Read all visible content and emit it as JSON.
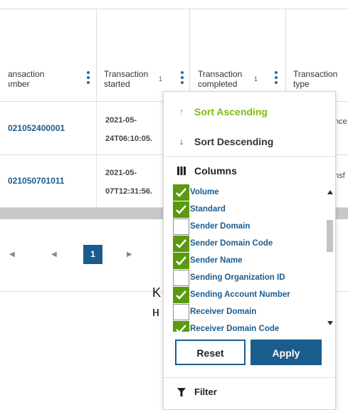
{
  "columns": [
    {
      "label_line1": "ansaction",
      "label_line2": "ımber"
    },
    {
      "label_line1": "Transaction",
      "label_line2": "started",
      "sort_index": "1"
    },
    {
      "label_line1": "Transaction",
      "label_line2": "completed",
      "sort_index": "1"
    },
    {
      "label_line1": "Transaction",
      "label_line2": "type"
    }
  ],
  "rows": [
    {
      "number": "021052400001",
      "started_line1": "2021-05-",
      "started_line2": "24T06:10:05.",
      "type_fragment": "nce"
    },
    {
      "number": "021050701011",
      "started_line1": "2021-05-",
      "started_line2": "07T12:31:56.",
      "type_fragment": "nsf"
    }
  ],
  "pagination": {
    "current_page": "1"
  },
  "background_fragments": {
    "char1": "K",
    "char2": "н"
  },
  "column_menu": {
    "sort_ascending": {
      "label": "Sort Ascending",
      "icon": "arrow-up-icon"
    },
    "sort_descending": {
      "label": "Sort Descending",
      "icon": "arrow-down-icon"
    },
    "columns": {
      "label": "Columns",
      "icon": "columns-icon"
    },
    "column_options": [
      {
        "label": "Volume",
        "checked": true
      },
      {
        "label": "Standard",
        "checked": true
      },
      {
        "label": "Sender Domain",
        "checked": false
      },
      {
        "label": "Sender Domain Code",
        "checked": true
      },
      {
        "label": "Sender Name",
        "checked": true
      },
      {
        "label": "Sending Organization ID",
        "checked": false
      },
      {
        "label": "Sending Account Number",
        "checked": true
      },
      {
        "label": "Receiver Domain",
        "checked": false
      },
      {
        "label": "Receiver Domain Code",
        "checked": true
      }
    ],
    "reset_label": "Reset",
    "apply_label": "Apply",
    "filter": {
      "label": "Filter",
      "icon": "filter-icon"
    }
  },
  "colors": {
    "accent_blue": "#1b5c8f",
    "check_green": "#5a9a0e",
    "sort_active": "#7cbb14"
  }
}
